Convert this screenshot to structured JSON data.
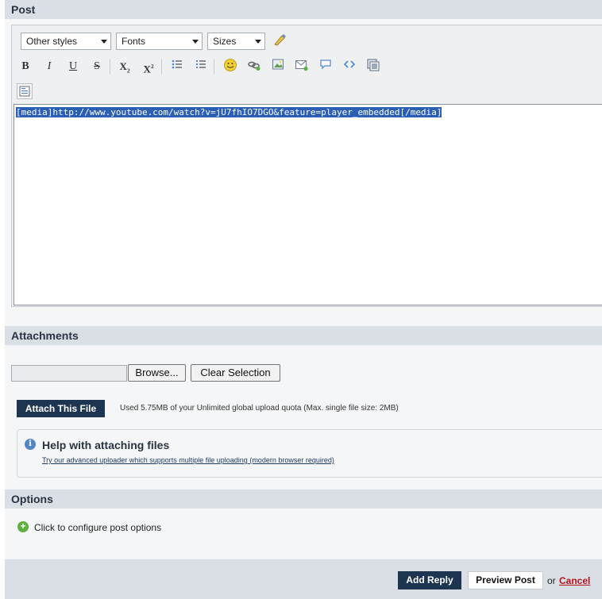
{
  "post": {
    "title": "Post",
    "toolbar": {
      "styles_select": "Other styles",
      "fonts_select": "Fonts",
      "sizes_select": "Sizes",
      "bold": "B",
      "italic": "I",
      "underline": "U",
      "strike": "S",
      "subscript": "X",
      "superscript": "X"
    },
    "content": "[media]http://www.youtube.com/watch?v=jU7fhIO7DGO&feature=player_embedded[/media]"
  },
  "attachments": {
    "title": "Attachments",
    "browse_label": "Browse...",
    "clear_label": "Clear Selection",
    "attach_label": "Attach This File",
    "quota_text": "Used 5.75MB of your Unlimited global upload quota (Max. single file size: 2MB)",
    "help_title": "Help with attaching files",
    "help_link": "Try our advanced uploader which supports multiple file uploading (modern browser required)"
  },
  "options": {
    "title": "Options",
    "configure_text": "Click to configure post options"
  },
  "footer": {
    "add_reply": "Add Reply",
    "preview_post": "Preview Post",
    "or": "or",
    "cancel": "Cancel"
  }
}
